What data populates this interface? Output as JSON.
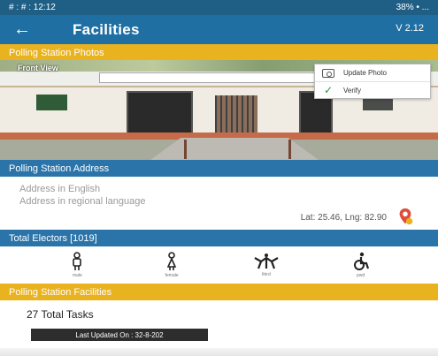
{
  "status_bar": {
    "time": "# : # : 12:12",
    "right_text": "38% • ..."
  },
  "app_bar": {
    "title": "Facilities",
    "version": "V 2.12"
  },
  "sections": {
    "photos": "Polling Station Photos",
    "address": "Polling Station Address",
    "electors": "Total Electors [1019]",
    "facilities": "Polling Station Facilities"
  },
  "photo": {
    "label": "Front View"
  },
  "photo_menu": {
    "items": [
      {
        "label": "Update Photo",
        "icon": "photo-icon"
      },
      {
        "label": "Verify",
        "icon": "check-icon"
      }
    ]
  },
  "address": {
    "english": "Address in English",
    "regional": "Address in regional language",
    "coords": "Lat: 25.46, Lng: 82.90"
  },
  "elector_icons": [
    {
      "icon": "male-voter-icon",
      "caption": "male"
    },
    {
      "icon": "female-voter-icon",
      "caption": "female"
    },
    {
      "icon": "third-gender-icon",
      "caption": "third"
    },
    {
      "icon": "wheelchair-icon",
      "caption": "pwd"
    }
  ],
  "facilities": {
    "total_tasks": "27 Total Tasks",
    "last_updated": "Last Updated On : 32-8-202"
  },
  "colors": {
    "status_bar": "#1f5f86",
    "app_bar": "#1f6fa2",
    "accent_yellow": "#e9b21f",
    "section_blue": "#2a74a9"
  }
}
